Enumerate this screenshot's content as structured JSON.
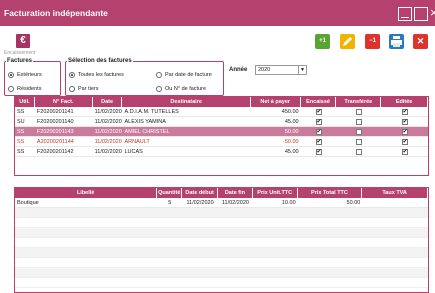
{
  "window": {
    "title": "Facturation indépendante"
  },
  "encaissement": {
    "icon_glyph": "€",
    "label": "Encaissement"
  },
  "factures": {
    "legend": "Factures",
    "options": [
      {
        "label": "Extérieurs",
        "selected": true
      },
      {
        "label": "Résidents",
        "selected": false
      }
    ]
  },
  "selection": {
    "legend": "Sélection des factures",
    "options": [
      {
        "label": "Toutes les factures",
        "selected": true
      },
      {
        "label": "Par tiers",
        "selected": false
      },
      {
        "label": "Par date de facture",
        "selected": false
      },
      {
        "label": "Ou N° de facture",
        "selected": false
      }
    ]
  },
  "year": {
    "label": "Année",
    "value": "2020"
  },
  "toolbar": {
    "add_label": "+1",
    "minus_label": "−1",
    "delete_label": "✕"
  },
  "invoices": {
    "headers": [
      "Util.",
      "N° Fact.",
      "Date",
      "Destinataire",
      "Net à payer",
      "Encaissé",
      "Transférée",
      "Editée"
    ],
    "rows": [
      {
        "util": "SS",
        "num": "F20200201141",
        "date": "11/02/2020",
        "dest": "A.D.I.A.M. TUTELLES",
        "net": "450.00",
        "encaisse": true,
        "transferee": false,
        "editee": true,
        "state": "normal"
      },
      {
        "util": "SU",
        "num": "F20200201140",
        "date": "11/02/2020",
        "dest": "ALEXIS YAMINA",
        "net": "45.00",
        "encaisse": true,
        "transferee": false,
        "editee": true,
        "state": "normal"
      },
      {
        "util": "SS",
        "num": "F20200201143",
        "date": "11/02/2020",
        "dest": "AMIEL CHRISTEL",
        "net": "50.00",
        "encaisse": true,
        "transferee": false,
        "editee": true,
        "state": "selected"
      },
      {
        "util": "SS",
        "num": "A20200201144",
        "date": "11/02/2020",
        "dest": "ARNAULT",
        "net": "-50.00",
        "encaisse": true,
        "transferee": false,
        "editee": true,
        "state": "red"
      },
      {
        "util": "SS",
        "num": "F20200201142",
        "date": "11/02/2020",
        "dest": "LUCAS",
        "net": "45.00",
        "encaisse": true,
        "transferee": false,
        "editee": true,
        "state": "normal"
      }
    ]
  },
  "lines": {
    "headers": [
      "Libellé",
      "Quantité",
      "Date début",
      "Date fin",
      "Prix Unit.TTC",
      "Prix Total TTC",
      "Taux TVA"
    ],
    "rows": [
      {
        "libelle": "Boutique",
        "quantite": "5",
        "debut": "11/02/2020",
        "fin": "11/02/2020",
        "prix_unit": "10.00",
        "prix_total": "50.00",
        "tva": ""
      }
    ]
  },
  "colors": {
    "accent": "#b5416e",
    "selected_row": "#c97b9e",
    "negative": "#c0392b"
  }
}
